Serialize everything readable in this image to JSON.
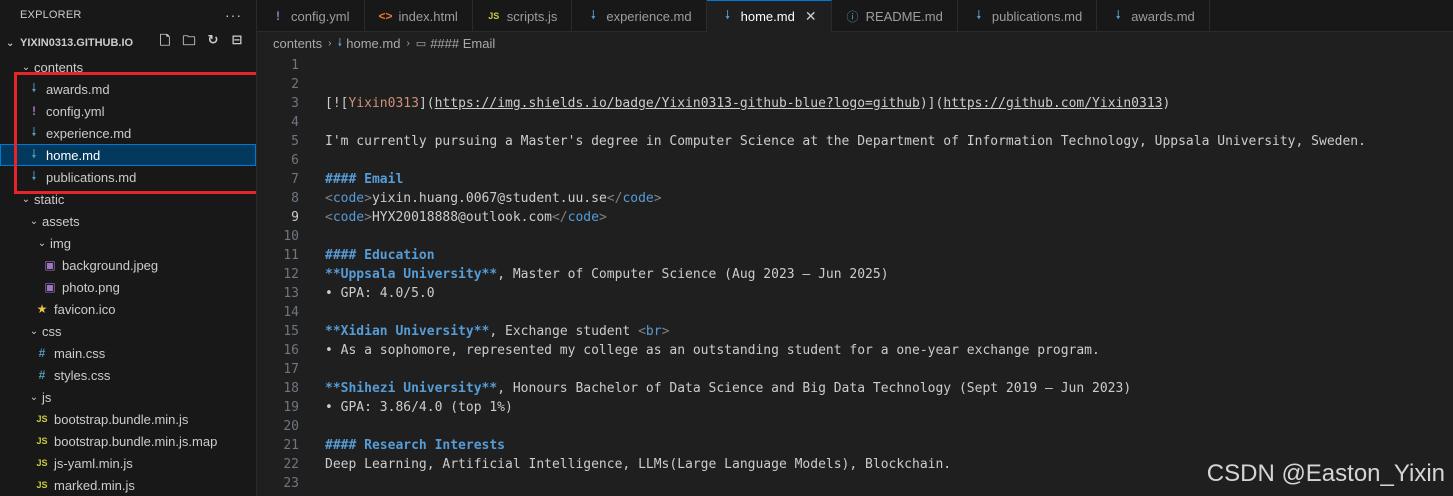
{
  "explorer": {
    "title": "EXPLORER",
    "more": "···",
    "project": "YIXIN0313.GITHUB.IO",
    "tree": [
      {
        "label": "contents",
        "type": "folder",
        "depth": 0,
        "icon": "chevron-down"
      },
      {
        "label": "awards.md",
        "type": "md",
        "depth": 1
      },
      {
        "label": "config.yml",
        "type": "yml",
        "depth": 1
      },
      {
        "label": "experience.md",
        "type": "md",
        "depth": 1
      },
      {
        "label": "home.md",
        "type": "md",
        "depth": 1,
        "selected": true
      },
      {
        "label": "publications.md",
        "type": "md",
        "depth": 1
      },
      {
        "label": "static",
        "type": "folder",
        "depth": 0
      },
      {
        "label": "assets",
        "type": "folder",
        "depth": 1
      },
      {
        "label": "img",
        "type": "folder",
        "depth": 2
      },
      {
        "label": "background.jpeg",
        "type": "img",
        "depth": 3
      },
      {
        "label": "photo.png",
        "type": "img",
        "depth": 3
      },
      {
        "label": "favicon.ico",
        "type": "fav",
        "depth": 2
      },
      {
        "label": "css",
        "type": "folder",
        "depth": 1
      },
      {
        "label": "main.css",
        "type": "css",
        "depth": 2
      },
      {
        "label": "styles.css",
        "type": "css",
        "depth": 2
      },
      {
        "label": "js",
        "type": "folder",
        "depth": 1
      },
      {
        "label": "bootstrap.bundle.min.js",
        "type": "js",
        "depth": 2
      },
      {
        "label": "bootstrap.bundle.min.js.map",
        "type": "js",
        "depth": 2
      },
      {
        "label": "js-yaml.min.js",
        "type": "js",
        "depth": 2
      },
      {
        "label": "marked.min.js",
        "type": "js",
        "depth": 2
      }
    ]
  },
  "tabs": [
    {
      "label": "config.yml",
      "icon": "!",
      "type": "yml"
    },
    {
      "label": "index.html",
      "icon": "<>",
      "type": "html"
    },
    {
      "label": "scripts.js",
      "icon": "JS",
      "type": "js"
    },
    {
      "label": "experience.md",
      "icon": "md",
      "type": "md"
    },
    {
      "label": "home.md",
      "icon": "md",
      "type": "md",
      "active": true,
      "close": "✕"
    },
    {
      "label": "README.md",
      "icon": "ⓘ",
      "type": "info"
    },
    {
      "label": "publications.md",
      "icon": "md",
      "type": "md"
    },
    {
      "label": "awards.md",
      "icon": "md",
      "type": "md"
    }
  ],
  "breadcrumb": {
    "folder": "contents",
    "file": "home.md",
    "symbol": "#### Email"
  },
  "editor": {
    "current_line": 9,
    "lines": [
      {
        "n": "1",
        "parts": []
      },
      {
        "n": "2",
        "parts": []
      },
      {
        "n": "3",
        "parts": [
          {
            "t": "[![",
            "c": ""
          },
          {
            "t": "Yixin0313",
            "c": "tok-link"
          },
          {
            "t": "](",
            "c": ""
          },
          {
            "t": "https://img.shields.io/badge/Yixin0313-github-blue?logo=github",
            "c": "tok-url"
          },
          {
            "t": ")](",
            "c": ""
          },
          {
            "t": "https://github.com/Yixin0313",
            "c": "tok-url"
          },
          {
            "t": ")",
            "c": ""
          }
        ]
      },
      {
        "n": "4",
        "parts": []
      },
      {
        "n": "5",
        "parts": [
          {
            "t": "I'm currently pursuing a Master's degree in Computer Science at the Department of Information Technology, Uppsala University, Sweden.",
            "c": ""
          }
        ]
      },
      {
        "n": "6",
        "parts": []
      },
      {
        "n": "7",
        "parts": [
          {
            "t": "#### Email",
            "c": "tok-heading"
          }
        ]
      },
      {
        "n": "8",
        "parts": [
          {
            "t": "<",
            "c": "tok-tag"
          },
          {
            "t": "code",
            "c": "tok-tagname"
          },
          {
            "t": ">",
            "c": "tok-tag"
          },
          {
            "t": "yixin.huang.0067@student.uu.se",
            "c": ""
          },
          {
            "t": "</",
            "c": "tok-tag"
          },
          {
            "t": "code",
            "c": "tok-tagname"
          },
          {
            "t": ">",
            "c": "tok-tag"
          }
        ]
      },
      {
        "n": "9",
        "parts": [
          {
            "t": "<",
            "c": "tok-tag"
          },
          {
            "t": "code",
            "c": "tok-tagname"
          },
          {
            "t": ">",
            "c": "tok-tag"
          },
          {
            "t": "HYX20018888@outlook.com",
            "c": ""
          },
          {
            "t": "</",
            "c": "tok-tag"
          },
          {
            "t": "code",
            "c": "tok-tagname"
          },
          {
            "t": ">",
            "c": "tok-tag"
          }
        ]
      },
      {
        "n": "10",
        "parts": []
      },
      {
        "n": "11",
        "parts": [
          {
            "t": "#### Education",
            "c": "tok-heading"
          }
        ]
      },
      {
        "n": "12",
        "parts": [
          {
            "t": "**Uppsala University**",
            "c": "tok-bold"
          },
          {
            "t": ", Master of Computer Science (Aug 2023 – Jun 2025)",
            "c": ""
          }
        ]
      },
      {
        "n": "13",
        "parts": [
          {
            "t": "• GPA: 4.0/5.0",
            "c": ""
          }
        ]
      },
      {
        "n": "14",
        "parts": []
      },
      {
        "n": "15",
        "parts": [
          {
            "t": "**Xidian University**",
            "c": "tok-bold"
          },
          {
            "t": ", Exchange student ",
            "c": ""
          },
          {
            "t": "<",
            "c": "tok-tag"
          },
          {
            "t": "br",
            "c": "tok-tagname"
          },
          {
            "t": ">",
            "c": "tok-tag"
          }
        ]
      },
      {
        "n": "16",
        "parts": [
          {
            "t": "• As a sophomore, represented my college as an outstanding student for a one-year exchange program.",
            "c": ""
          }
        ]
      },
      {
        "n": "17",
        "parts": []
      },
      {
        "n": "18",
        "parts": [
          {
            "t": "**Shihezi University**",
            "c": "tok-bold"
          },
          {
            "t": ", Honours Bachelor of Data Science and Big Data Technology (Sept 2019 – Jun 2023)",
            "c": ""
          }
        ]
      },
      {
        "n": "19",
        "parts": [
          {
            "t": "• GPA: 3.86/4.0 (top 1%)",
            "c": ""
          }
        ]
      },
      {
        "n": "20",
        "parts": []
      },
      {
        "n": "21",
        "parts": [
          {
            "t": "#### Research Interests",
            "c": "tok-heading"
          }
        ]
      },
      {
        "n": "22",
        "parts": [
          {
            "t": "Deep Learning, Artificial Intelligence, LLMs(Large Language Models), Blockchain.",
            "c": ""
          }
        ]
      },
      {
        "n": "23",
        "parts": []
      }
    ]
  },
  "watermark": "CSDN @Easton_Yixin",
  "colors": {
    "highlight_box": "#e5252a",
    "accent": "#0078d4",
    "md_icon": "#519aba",
    "heading": "#569cd6"
  }
}
